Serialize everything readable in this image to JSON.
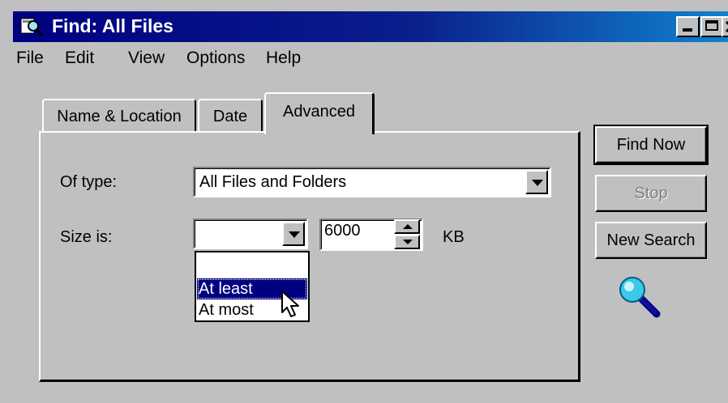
{
  "window": {
    "title": "Find: All Files"
  },
  "menu": {
    "file": "File",
    "edit": "Edit",
    "view": "View",
    "options": "Options",
    "help": "Help"
  },
  "tabs": {
    "name_location": "Name & Location",
    "date": "Date",
    "advanced": "Advanced",
    "active": "Advanced"
  },
  "advanced": {
    "of_type_label": "Of type:",
    "of_type_value": "All Files and Folders",
    "size_is_label": "Size is:",
    "size_mode_value": "",
    "size_value": "6000",
    "size_unit": "KB",
    "size_mode_options": [
      "",
      "At least",
      "At most"
    ],
    "highlighted_option": "At least"
  },
  "buttons": {
    "find_now": "Find Now",
    "stop": "Stop",
    "new_search": "New Search"
  },
  "icons": {
    "title": "find-magnifier-icon",
    "search": "magnifying-glass-icon",
    "cursor": "mouse-pointer-icon"
  },
  "colors": {
    "titlebar": "#000080",
    "face": "#c0c0c0",
    "selection": "#000080"
  }
}
